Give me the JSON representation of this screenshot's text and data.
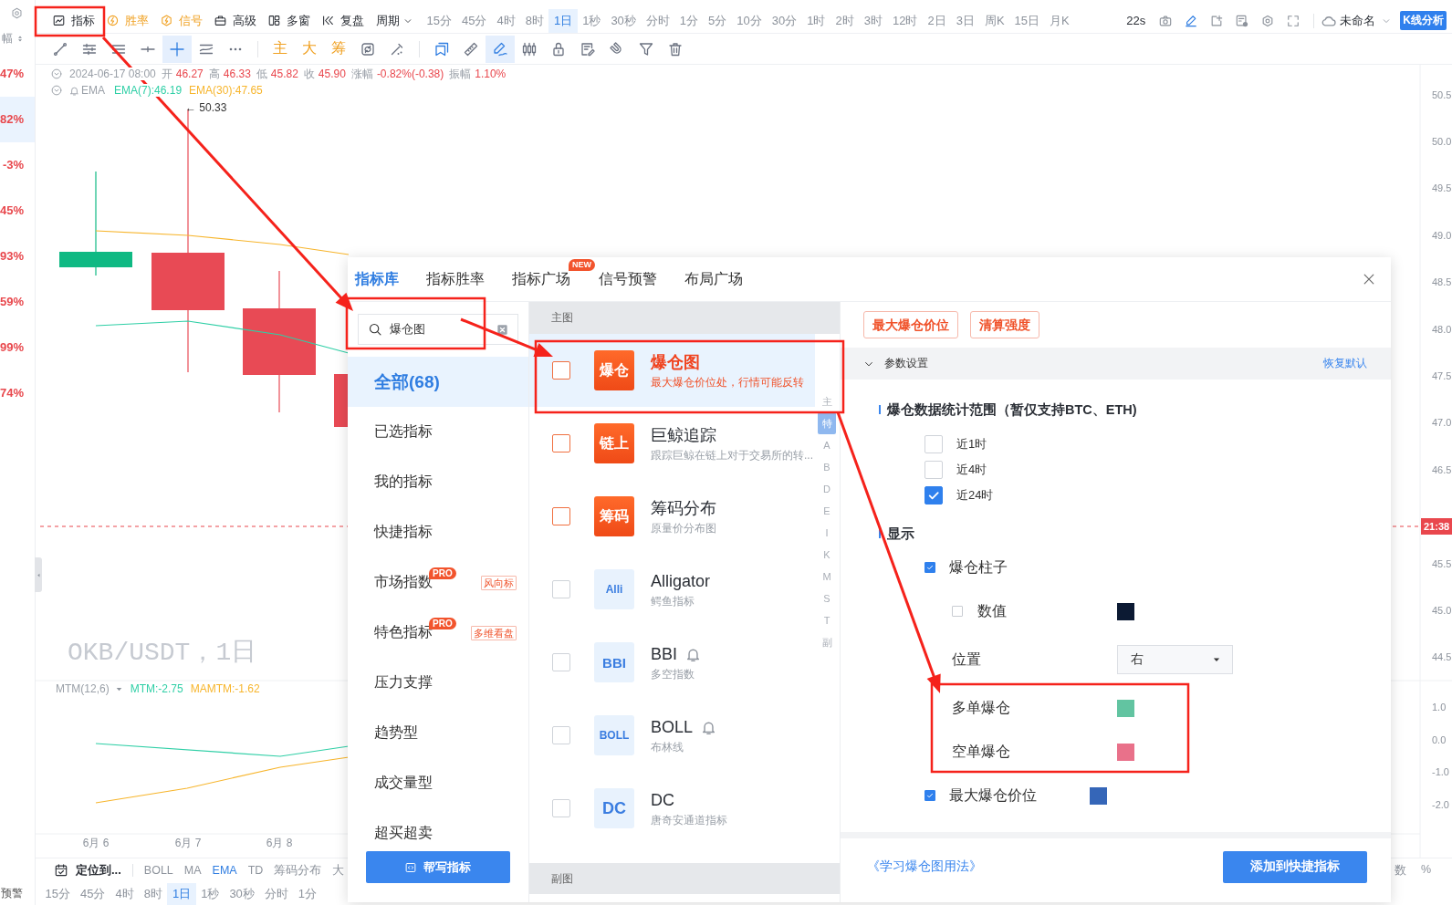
{
  "side_panel": {
    "sort_label": "幅",
    "changes": [
      {
        "value": "47%",
        "selected": false
      },
      {
        "value": "82%",
        "selected": true
      },
      {
        "value": "-3%",
        "selected": false
      },
      {
        "value": "45%",
        "selected": false
      },
      {
        "value": "93%",
        "selected": false
      },
      {
        "value": "59%",
        "selected": false
      },
      {
        "value": "99%",
        "selected": false
      },
      {
        "value": "74%",
        "selected": false
      }
    ],
    "alert_label": "预警"
  },
  "toolbar": {
    "tools": [
      {
        "label": "指标",
        "kind": "standard"
      },
      {
        "label": "胜率",
        "kind": "premium"
      },
      {
        "label": "信号",
        "kind": "premium"
      },
      {
        "label": "高级",
        "kind": "standard"
      },
      {
        "label": "多窗",
        "kind": "standard"
      },
      {
        "label": "复盘",
        "kind": "standard"
      }
    ],
    "period_menu": "周期",
    "periods": [
      {
        "label": "15分",
        "selected": false
      },
      {
        "label": "45分",
        "selected": false
      },
      {
        "label": "4时",
        "selected": false
      },
      {
        "label": "8时",
        "selected": false
      },
      {
        "label": "1日",
        "selected": true
      },
      {
        "label": "1秒",
        "selected": false
      },
      {
        "label": "30秒",
        "selected": false
      },
      {
        "label": "分时",
        "selected": false
      },
      {
        "label": "1分",
        "selected": false
      },
      {
        "label": "5分",
        "selected": false
      },
      {
        "label": "10分",
        "selected": false
      },
      {
        "label": "30分",
        "selected": false
      },
      {
        "label": "1时",
        "selected": false
      },
      {
        "label": "2时",
        "selected": false
      },
      {
        "label": "3时",
        "selected": false
      },
      {
        "label": "12时",
        "selected": false
      },
      {
        "label": "2日",
        "selected": false
      },
      {
        "label": "3日",
        "selected": false
      },
      {
        "label": "周K",
        "selected": false
      },
      {
        "label": "15日",
        "selected": false
      },
      {
        "label": "月K",
        "selected": false
      }
    ],
    "countdown": "22s",
    "layout_name": "未命名",
    "analysis_button": "K线分析"
  },
  "drawing_toolbar": {
    "tools": [
      {
        "selected": false
      },
      {
        "selected": false
      },
      {
        "selected": false
      },
      {
        "selected": false
      },
      {
        "selected": true
      },
      {
        "selected": false
      },
      {
        "selected": false
      }
    ],
    "mode_tools": [
      "主",
      "大",
      "筹"
    ],
    "object_tools": [
      {
        "selected": false
      },
      {
        "selected": false
      },
      {
        "selected": true
      },
      {
        "selected": false
      },
      {
        "selected": false
      },
      {
        "selected": false
      },
      {
        "selected": false
      },
      {
        "selected": false
      },
      {
        "selected": false
      }
    ]
  },
  "quote": {
    "datetime": "2024-06-17 08:00",
    "fields": [
      {
        "label": "开",
        "value": "46.27"
      },
      {
        "label": "高",
        "value": "46.33"
      },
      {
        "label": "低",
        "value": "45.82"
      },
      {
        "label": "收",
        "value": "45.90"
      },
      {
        "label": "涨幅",
        "value": "-0.82%(-0.38)"
      },
      {
        "label": "振幅",
        "value": "1.10%"
      }
    ]
  },
  "main_indicator": {
    "name": "EMA",
    "values": [
      {
        "text": "EMA(7):46.19",
        "color": "#2fcfa6"
      },
      {
        "text": "EMA(30):47.65",
        "color": "#f7b52c"
      }
    ]
  },
  "chart": {
    "high_label": "← 50.33",
    "watermark": "OKB/USDT，1日",
    "price_axis_upper": [
      "50.5",
      "50.0",
      "49.5",
      "49.0",
      "48.5",
      "48.0",
      "47.5",
      "47.0",
      "46.5"
    ],
    "price_axis_lower": [
      "45.5",
      "45.0",
      "44.5"
    ],
    "countdown_tag": "21:38",
    "dates": [
      "6月 6",
      "6月 7",
      "6月 8"
    ]
  },
  "sub_indicator": {
    "name": "MTM(12,6)",
    "values": [
      {
        "text": "MTM:-2.75",
        "color": "#2fcfa6"
      },
      {
        "text": "MAMTM:-1.62",
        "color": "#f7b52c"
      }
    ],
    "axis": [
      "1.0",
      "0.0",
      "-1.0",
      "-2.0"
    ]
  },
  "bottom_bar": {
    "locate_label": "定位到...",
    "indicators": [
      {
        "label": "BOLL",
        "selected": false
      },
      {
        "label": "MA",
        "selected": false
      },
      {
        "label": "EMA",
        "selected": true
      },
      {
        "label": "TD",
        "selected": false
      },
      {
        "label": "筹码分布",
        "selected": false
      },
      {
        "label": "大",
        "selected": false
      }
    ],
    "scale_labels": [
      "数",
      "%"
    ],
    "periods": [
      {
        "label": "15分",
        "selected": false
      },
      {
        "label": "45分",
        "selected": false
      },
      {
        "label": "4时",
        "selected": false
      },
      {
        "label": "8时",
        "selected": false
      },
      {
        "label": "1日",
        "selected": true
      },
      {
        "label": "1秒",
        "selected": false
      },
      {
        "label": "30秒",
        "selected": false
      },
      {
        "label": "分时",
        "selected": false
      },
      {
        "label": "1分",
        "selected": false
      }
    ]
  },
  "dialog": {
    "tabs": [
      {
        "label": "指标库",
        "selected": true
      },
      {
        "label": "指标胜率",
        "selected": false
      },
      {
        "label": "指标广场",
        "selected": false,
        "badge": "NEW"
      },
      {
        "label": "信号预警",
        "selected": false
      },
      {
        "label": "布局广场",
        "selected": false
      }
    ],
    "search": {
      "value": "爆仓图"
    },
    "categories": [
      {
        "label": "全部(68)",
        "selected": true
      },
      {
        "label": "已选指标",
        "selected": false
      },
      {
        "label": "我的指标",
        "selected": false
      },
      {
        "label": "快捷指标",
        "selected": false
      },
      {
        "label": "市场指数",
        "selected": false,
        "badge": "PRO",
        "tag": "风向标"
      },
      {
        "label": "特色指标",
        "selected": false,
        "badge": "PRO",
        "tag": "多维看盘"
      },
      {
        "label": "压力支撑",
        "selected": false
      },
      {
        "label": "趋势型",
        "selected": false
      },
      {
        "label": "成交量型",
        "selected": false
      },
      {
        "label": "超买超卖",
        "selected": false
      }
    ],
    "help_button": "帮写指标",
    "main_section": "主图",
    "indicators": [
      {
        "logo": "爆仓",
        "title": "爆仓图",
        "description": "最大爆仓价位处，行情可能反转",
        "kind": "featured",
        "checked": false,
        "selected": true,
        "alert": false
      },
      {
        "logo": "链上",
        "title": "巨鲸追踪",
        "description": "跟踪巨鲸在链上对于交易所的转...",
        "kind": "featured",
        "checked": false,
        "selected": false,
        "alert": false
      },
      {
        "logo": "筹码",
        "title": "筹码分布",
        "description": "原量价分布图",
        "kind": "featured",
        "checked": false,
        "selected": false,
        "alert": false
      },
      {
        "logo": "Alli",
        "title": "Alligator",
        "description": "鳄鱼指标",
        "kind": "standard",
        "checked": false,
        "selected": false,
        "alert": false
      },
      {
        "logo": "BBI",
        "title": "BBI",
        "description": "多空指数",
        "kind": "standard",
        "checked": false,
        "selected": false,
        "alert": true
      },
      {
        "logo": "BOLL",
        "title": "BOLL",
        "description": "布林线",
        "kind": "standard",
        "checked": false,
        "selected": false,
        "alert": true
      },
      {
        "logo": "DC",
        "title": "DC",
        "description": "唐奇安通道指标",
        "kind": "standard",
        "checked": false,
        "selected": false,
        "alert": false
      }
    ],
    "index": [
      {
        "label": "主",
        "selected": false
      },
      {
        "label": "特",
        "selected": true
      },
      {
        "label": "A",
        "selected": false
      },
      {
        "label": "B",
        "selected": false
      },
      {
        "label": "D",
        "selected": false
      },
      {
        "label": "E",
        "selected": false
      },
      {
        "label": "I",
        "selected": false
      },
      {
        "label": "K",
        "selected": false
      },
      {
        "label": "M",
        "selected": false
      },
      {
        "label": "S",
        "selected": false
      },
      {
        "label": "T",
        "selected": false
      },
      {
        "label": "副",
        "selected": false
      }
    ],
    "sub_section": "副图",
    "settings": {
      "tags": [
        "最大爆仓价位",
        "清算强度"
      ],
      "title": "参数设置",
      "expanded": true,
      "reset_link": "恢复默认",
      "range_title": "爆仓数据统计范围（暂仅支持BTC、ETH)",
      "ranges": [
        {
          "label": "近1时",
          "checked": false
        },
        {
          "label": "近4时",
          "checked": false
        },
        {
          "label": "近24时",
          "checked": true
        }
      ],
      "display_title": "显示",
      "display": [
        {
          "kind": "checkbox",
          "label": "爆仓柱子",
          "checked": true,
          "children": [
            {
              "kind": "checkbox_color",
              "label": "数值",
              "checked": false,
              "color": "#0c1a33"
            },
            {
              "kind": "select",
              "label": "位置",
              "value": "右"
            },
            {
              "kind": "color",
              "label": "多单爆仓",
              "color": "#62c4a1"
            },
            {
              "kind": "color",
              "label": "空单爆仓",
              "color": "#e9718a"
            }
          ]
        },
        {
          "kind": "checkbox_color",
          "label": "最大爆仓价位",
          "checked": true,
          "color": "#3566b8"
        }
      ]
    },
    "learn_link": "《学习爆仓图用法》",
    "add_button": "添加到快捷指标"
  }
}
